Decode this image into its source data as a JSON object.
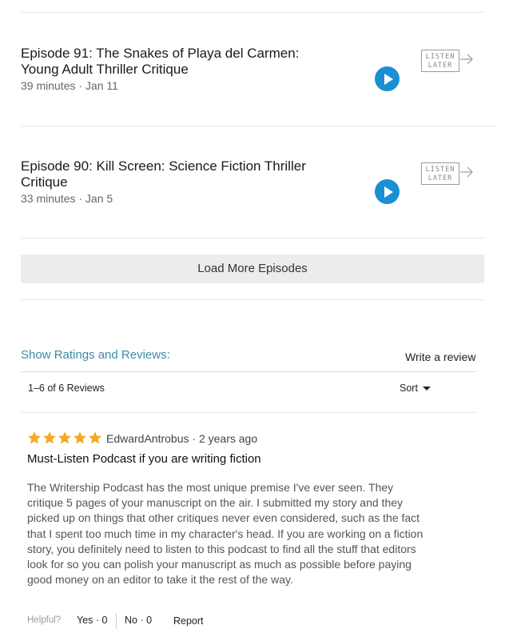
{
  "episodes": [
    {
      "title": "Episode 91: The Snakes of Playa del Carmen: Young Adult Thriller Critique",
      "meta": "39 minutes · Jan 11",
      "listen_later_line1": "LISTEN",
      "listen_later_line2": "LATER"
    },
    {
      "title": "Episode 90: Kill Screen: Science Fiction Thriller Critique",
      "meta": "33 minutes · Jan 5",
      "listen_later_line1": "LISTEN",
      "listen_later_line2": "LATER"
    }
  ],
  "load_more_label": "Load More Episodes",
  "reviews": {
    "header": "Show Ratings and Reviews:",
    "write_review_label": "Write a review",
    "count_text": "1–6 of 6 Reviews",
    "sort_label": "Sort",
    "items": [
      {
        "rating": 5,
        "author_line": "EdwardAntrobus · 2 years ago",
        "title": "Must-Listen Podcast if you are writing fiction",
        "body": "The Writership Podcast has the most unique premise I've ever seen. They critique 5 pages of your manuscript on the air. I submitted my story and they picked up on things that other critiques never even considered, such as the fact that I spent too much time in my character's head. If you are working on a fiction story, you definitely need to listen to this podcast to find all the stuff that editors look for so you can polish your manuscript as much as possible before paying good money on an editor to take it the rest of the way.",
        "helpful_label": "Helpful?",
        "yes_label": "Yes · 0",
        "no_label": "No · 0",
        "report_label": "Report"
      }
    ]
  },
  "colors": {
    "accent": "#3d8aa8",
    "play": "#1a8fd1",
    "star": "#f4a825"
  },
  "icons": {
    "play": "play-icon",
    "arrow": "arrow-right-icon",
    "star": "star-icon",
    "caret": "caret-down-icon"
  }
}
